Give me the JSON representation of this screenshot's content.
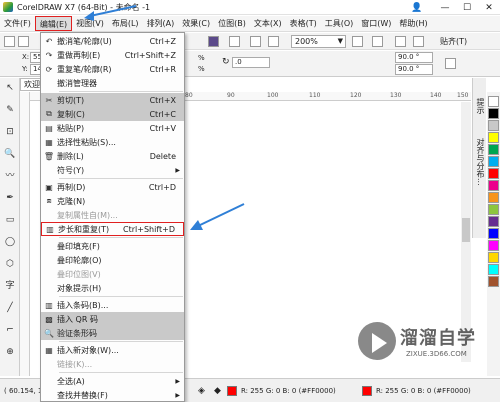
{
  "window": {
    "title": "CorelDRAW X7 (64-Bit) - 未命名 -1",
    "controls": [
      "—",
      "☐",
      "✕"
    ]
  },
  "menubar": {
    "items": [
      {
        "label": "文件(F)"
      },
      {
        "label": "编辑(E)",
        "active": true
      },
      {
        "label": "视图(V)"
      },
      {
        "label": "布局(L)"
      },
      {
        "label": "排列(A)"
      },
      {
        "label": "效果(C)"
      },
      {
        "label": "位图(B)"
      },
      {
        "label": "文本(X)"
      },
      {
        "label": "表格(T)"
      },
      {
        "label": "工具(O)"
      },
      {
        "label": "窗口(W)"
      },
      {
        "label": "帮助(H)"
      }
    ]
  },
  "toolbar": {
    "zoom_value": "200%",
    "snap_label": "贴齐(T)"
  },
  "propbar": {
    "x_label": "X:",
    "x_value": "55",
    "y_label": "Y:",
    "y_value": "14",
    "pct1": "%",
    "pct2": "%",
    "rotation": ".0",
    "angle1": "90.0 °",
    "angle2": "90.0 °"
  },
  "doc_tab": "欢迎",
  "ruler": {
    "marks": [
      "80",
      "90",
      "100",
      "110",
      "120",
      "130",
      "140",
      "150"
    ]
  },
  "docker": {
    "tab1": "提示",
    "tab2": "对齐与分布..."
  },
  "palette": {
    "colors": [
      "#ffffff",
      "#000000",
      "#c8c8c8",
      "#ffff00",
      "#00a650",
      "#00aeef",
      "#ff0000",
      "#ec008c",
      "#f7941d",
      "#8dc63f",
      "#662d91",
      "#0000ff",
      "#ff00ff",
      "#ffd700",
      "#00ffff",
      "#a0522d"
    ]
  },
  "statusbar": {
    "coords": "( 60.154, 1",
    "fill_text": "R: 255 G: 0 B: 0 (#FF0000)",
    "outline_text": "R: 255 G: 0 B: 0 (#FF0000)"
  },
  "edit_menu": {
    "items": [
      {
        "icon": "↶",
        "label": "撤消笔/轮廓(U)",
        "shortcut": "Ctrl+Z"
      },
      {
        "icon": "↷",
        "label": "重做再制(E)",
        "shortcut": "Ctrl+Shift+Z"
      },
      {
        "icon": "⟳",
        "label": "重复笔/轮廓(R)",
        "shortcut": "Ctrl+R"
      },
      {
        "icon": "",
        "label": "撤消管理器",
        "shortcut": "",
        "sep_after": true
      },
      {
        "icon": "✂",
        "label": "剪切(T)",
        "shortcut": "Ctrl+X",
        "highlight": true
      },
      {
        "icon": "⧉",
        "label": "复制(C)",
        "shortcut": "Ctrl+C",
        "highlight": true
      },
      {
        "icon": "▤",
        "label": "粘贴(P)",
        "shortcut": "Ctrl+V"
      },
      {
        "icon": "▦",
        "label": "选择性粘贴(S)...",
        "shortcut": ""
      },
      {
        "icon": "🗑",
        "label": "删除(L)",
        "shortcut": "Delete"
      },
      {
        "icon": "",
        "label": "符号(Y)",
        "shortcut": "",
        "submenu": true,
        "sep_after": true
      },
      {
        "icon": "▣",
        "label": "再制(D)",
        "shortcut": "Ctrl+D"
      },
      {
        "icon": "⧈",
        "label": "克隆(N)",
        "shortcut": ""
      },
      {
        "icon": "",
        "label": "复制属性自(M)...",
        "shortcut": "",
        "disabled": true
      },
      {
        "icon": "▥",
        "label": "步长和重复(T)",
        "shortcut": "Ctrl+Shift+D",
        "boxed": true,
        "sep_after": true
      },
      {
        "icon": "",
        "label": "叠印填充(F)",
        "shortcut": ""
      },
      {
        "icon": "",
        "label": "叠印轮廓(O)",
        "shortcut": ""
      },
      {
        "icon": "",
        "label": "叠印位图(V)",
        "shortcut": "",
        "disabled": true
      },
      {
        "icon": "",
        "label": "对象提示(H)",
        "shortcut": "",
        "sep_after": true
      },
      {
        "icon": "▥",
        "label": "插入条码(B)...",
        "shortcut": ""
      },
      {
        "icon": "▩",
        "label": "插入 QR 码",
        "shortcut": "",
        "highlight": true
      },
      {
        "icon": "🔍",
        "label": "验证条形码",
        "shortcut": "",
        "highlight": true,
        "sep_after": true
      },
      {
        "icon": "▦",
        "label": "插入新对象(W)...",
        "shortcut": ""
      },
      {
        "icon": "",
        "label": "链接(K)...",
        "shortcut": "",
        "disabled": true,
        "sep_after": true
      },
      {
        "icon": "",
        "label": "全选(A)",
        "shortcut": "",
        "submenu": true
      },
      {
        "icon": "",
        "label": "查找并替换(F)",
        "shortcut": "",
        "submenu": true
      }
    ]
  },
  "watermark": {
    "brand": "溜溜自学",
    "site": "ZIXUE.3D66.COM"
  }
}
